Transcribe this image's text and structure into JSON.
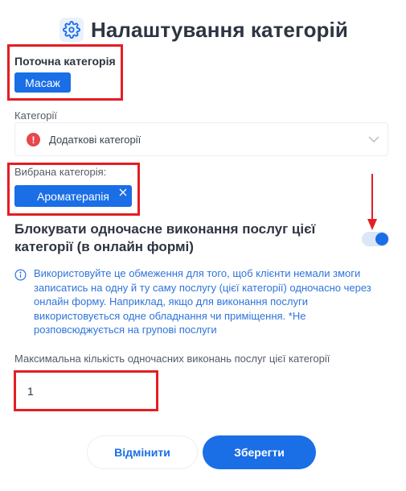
{
  "header": {
    "title": "Налаштування категорій",
    "icon": "gear-icon"
  },
  "current_category": {
    "label": "Поточна категорія",
    "value": "Масаж"
  },
  "categories": {
    "label": "Категорії",
    "selected": "Додаткові категорії",
    "warning_icon": "!"
  },
  "chosen_category": {
    "label": "Вибрана категорія:",
    "tag": "Ароматерапія"
  },
  "block_toggle": {
    "title": "Блокувати одночасне виконання послуг цієї категорії (в онлайн формі)",
    "enabled": true
  },
  "info": {
    "text": "Використовуйте це обмеження для того, щоб клієнти немали змоги записатись на одну й ту саму послугу (цієї категорії) одночасно через онлайн форму. Наприклад, якщо для виконання послуги використовується одне обладнання чи приміщення. *Не розповсюджується на групові послуги"
  },
  "max_concurrent": {
    "label": "Максимальна кількість одночасних виконань послуг цієї категорії",
    "value": "1"
  },
  "actions": {
    "cancel": "Відмінити",
    "save": "Зберегти"
  },
  "colors": {
    "accent": "#1a6ee6",
    "annotation": "#e31e24",
    "warning": "#e5484d",
    "info_text": "#2f74da"
  }
}
